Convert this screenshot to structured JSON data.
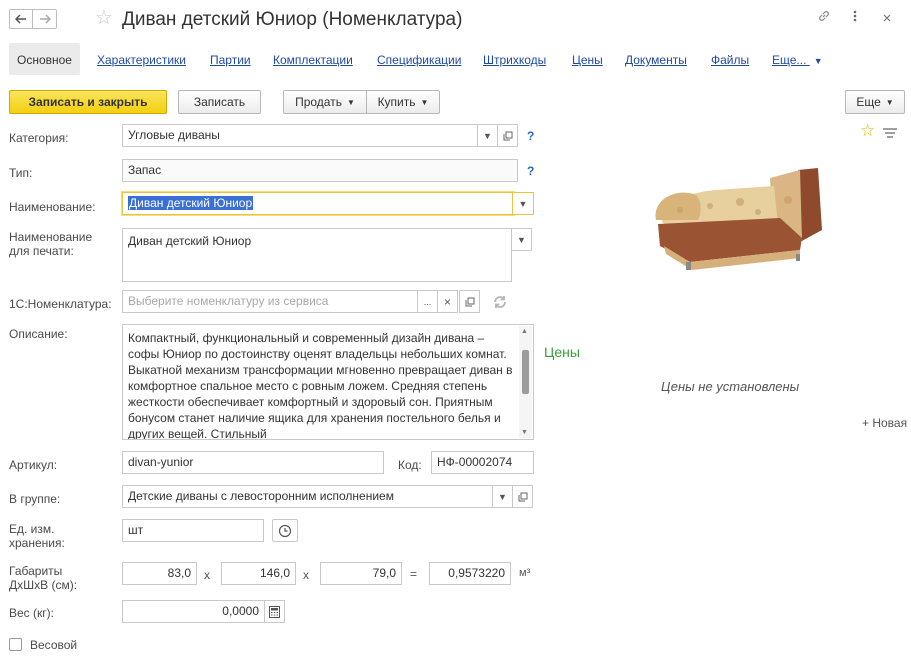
{
  "window": {
    "title": "Диван детский Юниор (Номенклатура)",
    "back_icon": "arrow-left-icon",
    "forward_icon": "arrow-right-icon",
    "link_icon": "link-icon",
    "menu_icon": "more-vertical-icon",
    "close_icon": "close-icon"
  },
  "tabs": [
    {
      "label": "Основное",
      "active": true
    },
    {
      "label": "Характеристики"
    },
    {
      "label": "Партии"
    },
    {
      "label": "Комплектации"
    },
    {
      "label": "Спецификации"
    },
    {
      "label": "Штрихкоды"
    },
    {
      "label": "Цены"
    },
    {
      "label": "Документы"
    },
    {
      "label": "Файлы"
    },
    {
      "label": "Еще..."
    }
  ],
  "toolbar": {
    "save_close": "Записать и закрыть",
    "save": "Записать",
    "sell": "Продать",
    "buy": "Купить",
    "more": "Еще"
  },
  "form": {
    "category": {
      "label": "Категория:",
      "value": "Угловые диваны"
    },
    "type": {
      "label": "Тип:",
      "value": "Запас"
    },
    "name": {
      "label": "Наименование:",
      "value": "Диван детский Юниор"
    },
    "print_name": {
      "label": "Наименование для печати:",
      "value": "Диван детский Юниор"
    },
    "nomenclature_1c": {
      "label": "1С:Номенклатура:",
      "placeholder": "Выберите номенклатуру из сервиса"
    },
    "description": {
      "label": "Описание:",
      "value": "Компактный, функциональный и современный дизайн дивана – софы Юниор по достоинству оценят владельцы небольших комнат. Выкатной механизм трансформации мгновенно превращает диван в комфортное спальное место с ровным ложем. Средняя степень жесткости обеспечивает комфортный и здоровый сон. Приятным бонусом станет наличие ящика для хранения постельного белья и других вещей. Стильный"
    },
    "article": {
      "label": "Артикул:",
      "value": "divan-yunior"
    },
    "code": {
      "label": "Код:",
      "value": "НФ-00002074"
    },
    "group": {
      "label": "В группе:",
      "value": "Детские диваны с левосторонним исполнением"
    },
    "unit": {
      "label": "Ед. изм. хранения:",
      "value": "шт"
    },
    "dimensions": {
      "label": "Габариты ДхШхВ (см):",
      "length": "83,0",
      "width": "146,0",
      "height": "79,0",
      "volume": "0,9573220",
      "unit": "м³",
      "times": "x",
      "equals": "="
    },
    "weight": {
      "label": "Вес (кг):",
      "value": "0,0000"
    },
    "weighted": {
      "label": "Весовой",
      "checked": false
    }
  },
  "prices": {
    "title": "Цены",
    "empty": "Цены не установлены",
    "new": "+ Новая"
  },
  "icons": {
    "help": "?",
    "dropdown": "▾",
    "open": "⧉",
    "clear": "×",
    "ellipsis": "...",
    "history": "clock-icon",
    "calculator": "calculator-icon",
    "favorite": "star-icon",
    "settings": "list-settings-icon"
  }
}
